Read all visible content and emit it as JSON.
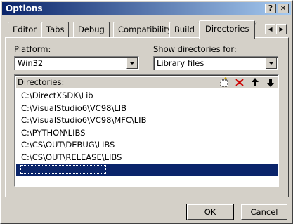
{
  "window": {
    "title": "Options"
  },
  "titlebar": {
    "help_label": "?",
    "close_label": "✕"
  },
  "tabs": [
    {
      "label": "Editor"
    },
    {
      "label": "Tabs"
    },
    {
      "label": "Debug"
    },
    {
      "label": "Compatibility"
    },
    {
      "label": "Build"
    },
    {
      "label": "Directories",
      "active": true
    }
  ],
  "tab_scroll": {
    "left": "◀",
    "right": "▶"
  },
  "platform": {
    "label": "Platform:",
    "value": "Win32"
  },
  "show_dirs": {
    "label": "Show directories for:",
    "value": "Library files"
  },
  "directories": {
    "label": "Directories:",
    "items": [
      "C:\\DirectXSDK\\Lib",
      "C:\\VisualStudio6\\VC98\\LIB",
      "C:\\VisualStudio6\\VC98\\MFC\\LIB",
      "C:\\PYTHON\\LIBS",
      "C:\\CS\\OUT\\DEBUG\\LIBS",
      "C:\\CS\\OUT\\RELEASE\\LIBS",
      ""
    ],
    "selected_index": 6,
    "toolbar": [
      "new-folder-icon",
      "delete-icon",
      "move-up-icon",
      "move-down-icon"
    ]
  },
  "buttons": {
    "ok": "OK",
    "cancel": "Cancel"
  },
  "colors": {
    "title_start": "#0a246a",
    "title_end": "#a6caf0",
    "selection": "#0a246a",
    "delete_red": "#cc0000"
  }
}
